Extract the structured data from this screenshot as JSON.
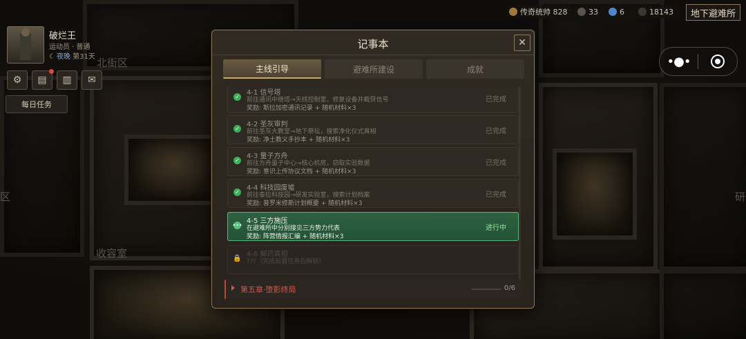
{
  "hud": {
    "legend_label": "传奇统帅",
    "legend_value": "828",
    "res1": "33",
    "res2": "6",
    "res3": "18143",
    "shelter_button": "地下避难所"
  },
  "map": {
    "label_north": "北街区",
    "label_storage": "收容室",
    "label_left": "区",
    "label_right": "研"
  },
  "player": {
    "name": "破烂王",
    "role": "运动员 · 普通",
    "phase": "夜晚",
    "day": "第31天"
  },
  "quick": {
    "daily_tasks": "每日任务"
  },
  "notebook": {
    "title": "记事本",
    "close_glyph": "✕",
    "tabs": [
      "主线引导",
      "避难所建设",
      "成就"
    ],
    "tasks": [
      {
        "title": "4-1 信号塔",
        "desc": "前往通讯中继塔→天线控制室，修复设备并截获信号",
        "reward": "奖励: 斯拉加密通讯记录 + 随机材料×3",
        "status": "已完成"
      },
      {
        "title": "4-2 圣灰审判",
        "desc": "前往圣灰大教堂→地下祭坛，搜索净化仪式真相",
        "reward": "奖励: 净土教义手抄本 + 随机材料×3",
        "status": "已完成"
      },
      {
        "title": "4-3 量子方舟",
        "desc": "前往方舟量子中心→核心机房，窃取实验数据",
        "reward": "奖励: 意识上传协议文档 + 随机材料×3",
        "status": "已完成"
      },
      {
        "title": "4-4 科技园废墟",
        "desc": "前往泰拉科技园→研发实验室，搜索计划档案",
        "reward": "奖励: 普罗米修斯计划概要 + 随机材料×3",
        "status": "已完成"
      },
      {
        "title": "4-5 三方施压",
        "desc": "在避难所中分别接见三方势力代表",
        "reward": "奖励: 阵营情报汇编 + 随机材料×3",
        "status": "进行中"
      },
      {
        "title": "4-6 解药真相",
        "desc": "???（完成前置任务后解锁）",
        "reward": "",
        "status": ""
      }
    ],
    "chapter": {
      "title": "第五章·堕影终局",
      "progress": "0/6"
    }
  },
  "colors": {
    "accent_gold": "#c9a86a",
    "in_progress_green": "#59b57a",
    "done_check": "#3fae57",
    "chapter_red": "#d0584a"
  },
  "icons": [
    "gear-icon",
    "journal-icon",
    "book-icon",
    "mail-icon",
    "check-icon",
    "lock-icon",
    "close-icon",
    "more-icon",
    "target-icon"
  ]
}
